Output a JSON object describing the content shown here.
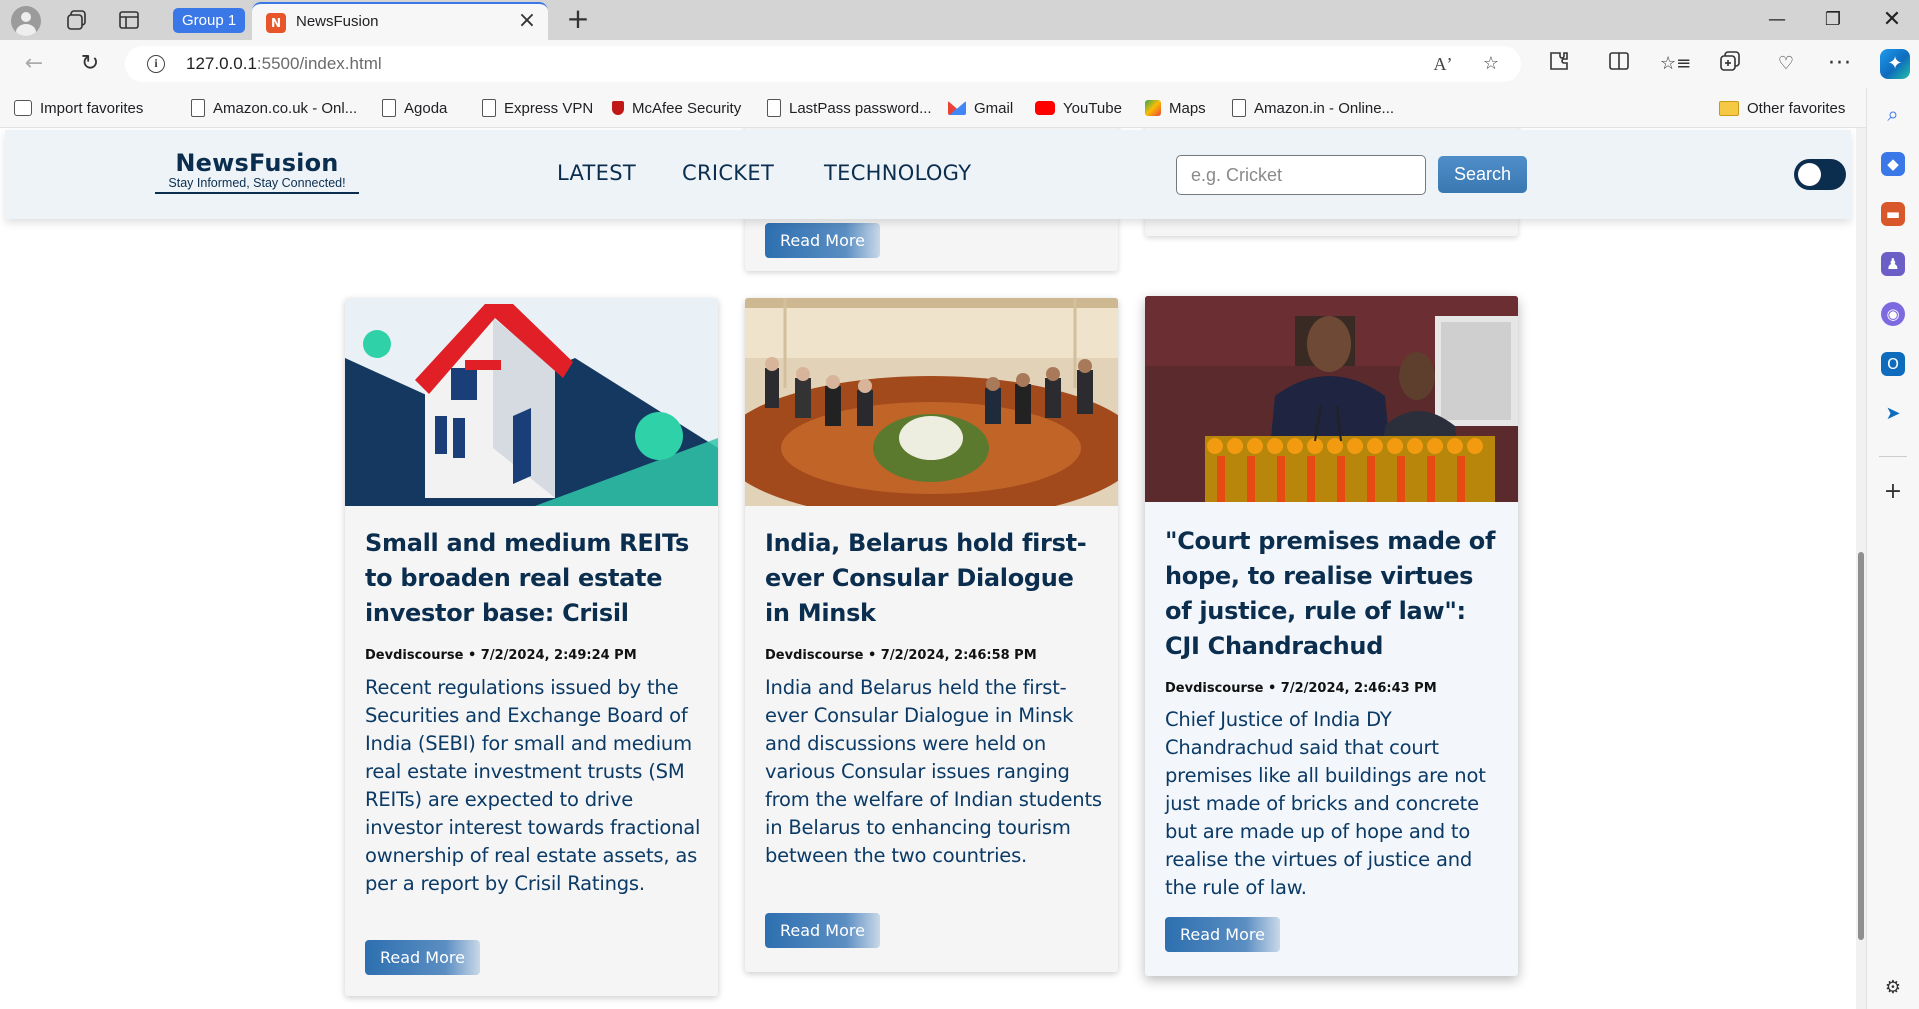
{
  "browser": {
    "group_label": "Group 1",
    "tab_title": "NewsFusion",
    "tab_favicon": "N",
    "url_host": "127.0.0.1",
    "url_path": ":5500/index.html",
    "favorites": [
      {
        "label": "Import favorites",
        "icon": "import-icon"
      },
      {
        "label": "Amazon.co.uk - Onl...",
        "icon": "page-icon"
      },
      {
        "label": "Agoda",
        "icon": "page-icon"
      },
      {
        "label": "Express VPN",
        "icon": "page-icon"
      },
      {
        "label": "McAfee Security",
        "icon": "mcafee-icon"
      },
      {
        "label": "LastPass password...",
        "icon": "page-icon"
      },
      {
        "label": "Gmail",
        "icon": "gmail-icon"
      },
      {
        "label": "YouTube",
        "icon": "youtube-icon"
      },
      {
        "label": "Maps",
        "icon": "maps-icon"
      },
      {
        "label": "Amazon.in - Online...",
        "icon": "page-icon"
      }
    ],
    "other_favorites": "Other favorites"
  },
  "site": {
    "brand_name": "NewsFusion",
    "brand_tagline": "Stay Informed, Stay Connected!",
    "nav": [
      "LATEST",
      "CRICKET",
      "TECHNOLOGY"
    ],
    "search_placeholder": "e.g. Cricket",
    "search_button": "Search",
    "read_more": "Read More"
  },
  "articles": [
    {
      "title": "Small and medium REITs to broaden real estate investor base: Crisil",
      "meta": "Devdiscourse • 7/2/2024, 2:49:24 PM",
      "description": "Recent regulations issued by the Securities and Exchange Board of India (SEBI) for small and medium real estate investment trusts (SM REITs) are expected to drive investor interest towards fractional ownership of real estate assets, as per a report by Crisil Ratings.",
      "read_more": "Read More"
    },
    {
      "title": "India, Belarus hold first-ever Consular Dialogue in Minsk",
      "meta": "Devdiscourse • 7/2/2024, 2:46:58 PM",
      "description": "India and Belarus held the first-ever Consular Dialogue in Minsk and discussions were held on various Consular issues ranging from the welfare of Indian students in Belarus to enhancing tourism between the two countries.",
      "read_more": "Read More"
    },
    {
      "title": "\"Court premises made of hope, to realise virtues of justice, rule of law\": CJI Chandrachud",
      "meta": "Devdiscourse • 7/2/2024, 2:46:43 PM",
      "description": "Chief Justice of India DY Chandrachud said that court premises like all buildings are not just made of bricks and concrete but are made up of hope and to realise the virtues of justice and the rule of law.",
      "read_more": "Read More"
    }
  ],
  "colors": {
    "brand": "#0b2e4f",
    "accent": "#3a78b2",
    "tab_group": "#3b78e7"
  }
}
